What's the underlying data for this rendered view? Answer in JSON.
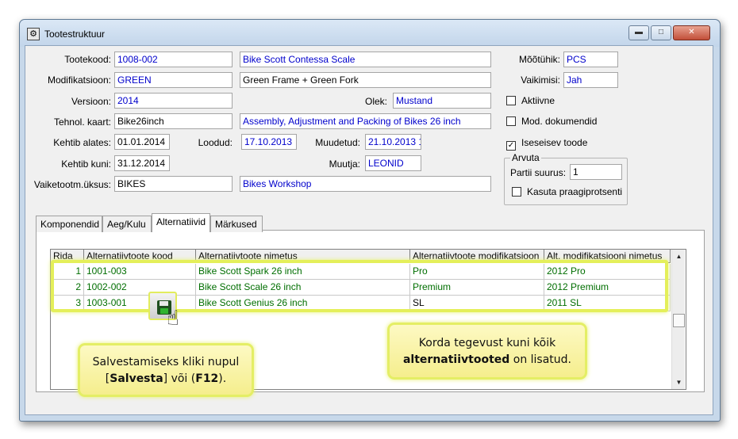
{
  "window": {
    "title": "Tootestruktuur",
    "minimize": "▬",
    "maximize": "□",
    "close": "✕",
    "app_icon": "⚙"
  },
  "form": {
    "tootekood": {
      "label": "Tootekood:",
      "value": "1008-002",
      "name": "Bike Scott Contessa Scale"
    },
    "modifikatsioon": {
      "label": "Modifikatsioon:",
      "value": "GREEN",
      "name": "Green Frame + Green Fork"
    },
    "versioon": {
      "label": "Versioon:",
      "value": "2014"
    },
    "olek": {
      "label": "Olek:",
      "value": "Mustand"
    },
    "tehnol_kaart": {
      "label": "Tehnol. kaart:",
      "value": "Bike26inch",
      "name": "Assembly, Adjustment and Packing of Bikes 26 inch"
    },
    "kehtib_alates": {
      "label": "Kehtib alates:",
      "value": "01.01.2014"
    },
    "loodud": {
      "label": "Loodud:",
      "value": "17.10.2013"
    },
    "muudetud": {
      "label": "Muudetud:",
      "value": "21.10.2013 1"
    },
    "kehtib_kuni": {
      "label": "Kehtib kuni:",
      "value": "31.12.2014"
    },
    "muutja": {
      "label": "Muutja:",
      "value": "LEONID"
    },
    "vaiketootm": {
      "label": "Vaiketootm.üksus:",
      "value": "BIKES",
      "name": "Bikes Workshop"
    },
    "mootuhik": {
      "label": "Mõõtühik:",
      "value": "PCS"
    },
    "vaikimisi": {
      "label": "Vaikimisi:",
      "value": "Jah"
    },
    "checks": {
      "aktiivne": {
        "label": "Aktiivne",
        "mark": ""
      },
      "mod_dokumendid": {
        "label": "Mod. dokumendid",
        "mark": ""
      },
      "iseseisev": {
        "label": "Iseseisev toode",
        "mark": "✓"
      }
    },
    "arvuta": {
      "title": "Arvuta",
      "partii_label": "Partii suurus:",
      "partii_value": "1",
      "praak_label": "Kasuta praagiprotsenti",
      "praak_mark": ""
    }
  },
  "tabs": [
    "Komponendid",
    "Aeg/Kulu",
    "Alternatiivid",
    "Märkused"
  ],
  "grid": {
    "headers": [
      "Rida",
      "Alternatiivtoote kood",
      "Alternatiivtoote nimetus",
      "Alternatiivtoote modifikatsioon",
      "Alt. modifikatsiooni nimetus"
    ],
    "rows": [
      [
        "1",
        "1001-003",
        "Bike Scott Spark 26 inch",
        "Pro",
        "2012 Pro"
      ],
      [
        "2",
        "1002-002",
        "Bike Scott Scale 26 inch",
        "Premium",
        "2012 Premium"
      ],
      [
        "3",
        "1003-001",
        "Bike Scott Genius 26 inch",
        "SL",
        "2011 SL"
      ]
    ]
  },
  "scrollbar": {
    "up": "▲",
    "down": "▼"
  },
  "callouts": {
    "left": {
      "line1": "Salvestamiseks kliki nupul",
      "open_bracket": "[",
      "strong1": "Salvesta",
      "mid": "] või (",
      "strong2": "F12",
      "close": ")."
    },
    "right": {
      "line1": "Korda tegevust kuni kõik",
      "strong": "alternatiivtooted",
      "rest": " on lisatud."
    }
  },
  "save_hint": {
    "hand": "☝"
  },
  "colors": {
    "highlight": "#e4ef5a",
    "grid_text": "#006e00",
    "field_blue": "#0000cc"
  }
}
